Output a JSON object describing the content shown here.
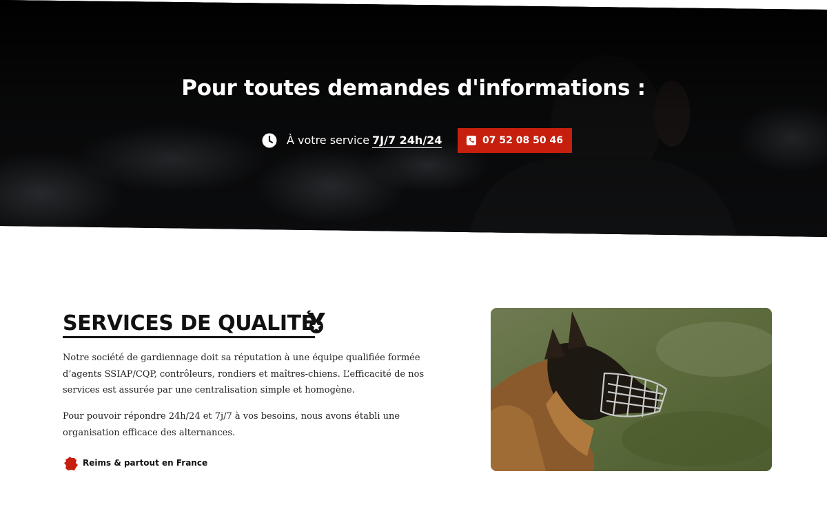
{
  "hero": {
    "title": "Pour toutes demandes d'informations :",
    "service_prefix": "À votre service",
    "service_hours": "7J/7 24h/24",
    "phone_label": "07 52 08 50 46",
    "icons": {
      "clock": "clock-icon",
      "phone": "phone-icon"
    },
    "colors": {
      "background": "#050505",
      "button": "#c61f0d"
    }
  },
  "section": {
    "title": "SERVICES DE QUALITÉ",
    "title_icon": "medal-icon",
    "paragraph_1": "Notre société de gardiennage doit sa réputation à une équipe qualifiée formée d’agents SSIAP/CQP, contrôleurs, rondiers et maîtres-chiens. L’efficacité de nos services est assurée par une centralisation simple et homogène.",
    "paragraph_2": "Pour pouvoir répondre 24h/24 et 7j/7 à vos besoins, nous avons établi une organisation efficace des alternances.",
    "location": "Reims & partout en France",
    "location_icon": "france-map-icon",
    "image_subject": "dog-photo",
    "accent_color": "#c61f0d"
  }
}
